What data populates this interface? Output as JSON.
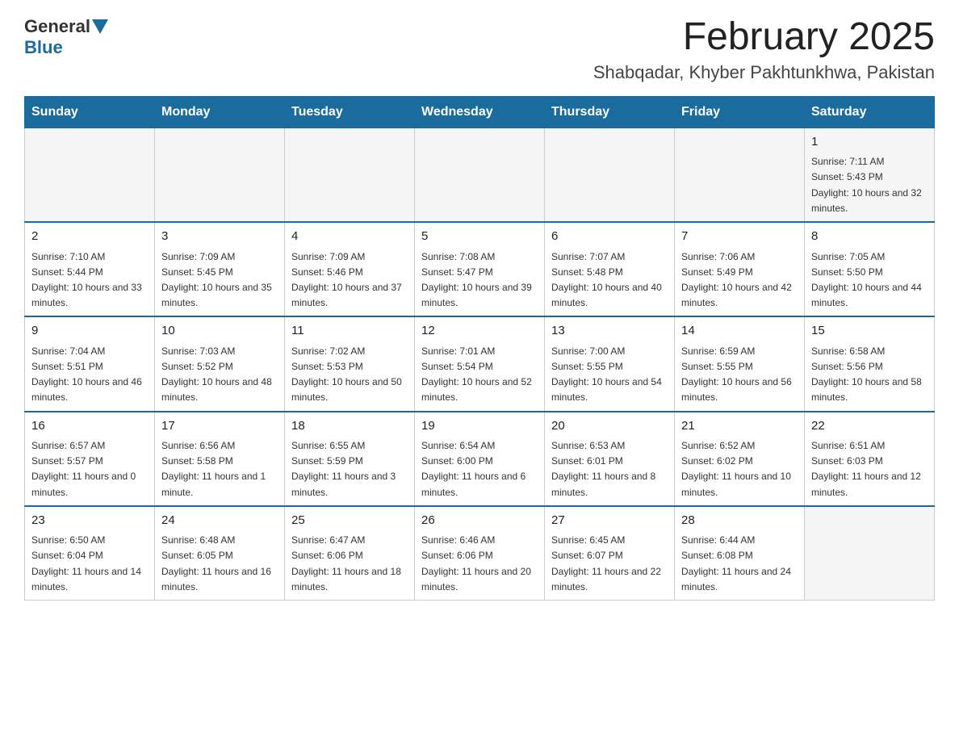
{
  "header": {
    "logo_general": "General",
    "logo_blue": "Blue",
    "month_title": "February 2025",
    "location": "Shabqadar, Khyber Pakhtunkhwa, Pakistan"
  },
  "days_of_week": [
    "Sunday",
    "Monday",
    "Tuesday",
    "Wednesday",
    "Thursday",
    "Friday",
    "Saturday"
  ],
  "weeks": [
    {
      "days": [
        {
          "num": "",
          "info": ""
        },
        {
          "num": "",
          "info": ""
        },
        {
          "num": "",
          "info": ""
        },
        {
          "num": "",
          "info": ""
        },
        {
          "num": "",
          "info": ""
        },
        {
          "num": "",
          "info": ""
        },
        {
          "num": "1",
          "info": "Sunrise: 7:11 AM\nSunset: 5:43 PM\nDaylight: 10 hours and 32 minutes."
        }
      ]
    },
    {
      "days": [
        {
          "num": "2",
          "info": "Sunrise: 7:10 AM\nSunset: 5:44 PM\nDaylight: 10 hours and 33 minutes."
        },
        {
          "num": "3",
          "info": "Sunrise: 7:09 AM\nSunset: 5:45 PM\nDaylight: 10 hours and 35 minutes."
        },
        {
          "num": "4",
          "info": "Sunrise: 7:09 AM\nSunset: 5:46 PM\nDaylight: 10 hours and 37 minutes."
        },
        {
          "num": "5",
          "info": "Sunrise: 7:08 AM\nSunset: 5:47 PM\nDaylight: 10 hours and 39 minutes."
        },
        {
          "num": "6",
          "info": "Sunrise: 7:07 AM\nSunset: 5:48 PM\nDaylight: 10 hours and 40 minutes."
        },
        {
          "num": "7",
          "info": "Sunrise: 7:06 AM\nSunset: 5:49 PM\nDaylight: 10 hours and 42 minutes."
        },
        {
          "num": "8",
          "info": "Sunrise: 7:05 AM\nSunset: 5:50 PM\nDaylight: 10 hours and 44 minutes."
        }
      ]
    },
    {
      "days": [
        {
          "num": "9",
          "info": "Sunrise: 7:04 AM\nSunset: 5:51 PM\nDaylight: 10 hours and 46 minutes."
        },
        {
          "num": "10",
          "info": "Sunrise: 7:03 AM\nSunset: 5:52 PM\nDaylight: 10 hours and 48 minutes."
        },
        {
          "num": "11",
          "info": "Sunrise: 7:02 AM\nSunset: 5:53 PM\nDaylight: 10 hours and 50 minutes."
        },
        {
          "num": "12",
          "info": "Sunrise: 7:01 AM\nSunset: 5:54 PM\nDaylight: 10 hours and 52 minutes."
        },
        {
          "num": "13",
          "info": "Sunrise: 7:00 AM\nSunset: 5:55 PM\nDaylight: 10 hours and 54 minutes."
        },
        {
          "num": "14",
          "info": "Sunrise: 6:59 AM\nSunset: 5:55 PM\nDaylight: 10 hours and 56 minutes."
        },
        {
          "num": "15",
          "info": "Sunrise: 6:58 AM\nSunset: 5:56 PM\nDaylight: 10 hours and 58 minutes."
        }
      ]
    },
    {
      "days": [
        {
          "num": "16",
          "info": "Sunrise: 6:57 AM\nSunset: 5:57 PM\nDaylight: 11 hours and 0 minutes."
        },
        {
          "num": "17",
          "info": "Sunrise: 6:56 AM\nSunset: 5:58 PM\nDaylight: 11 hours and 1 minute."
        },
        {
          "num": "18",
          "info": "Sunrise: 6:55 AM\nSunset: 5:59 PM\nDaylight: 11 hours and 3 minutes."
        },
        {
          "num": "19",
          "info": "Sunrise: 6:54 AM\nSunset: 6:00 PM\nDaylight: 11 hours and 6 minutes."
        },
        {
          "num": "20",
          "info": "Sunrise: 6:53 AM\nSunset: 6:01 PM\nDaylight: 11 hours and 8 minutes."
        },
        {
          "num": "21",
          "info": "Sunrise: 6:52 AM\nSunset: 6:02 PM\nDaylight: 11 hours and 10 minutes."
        },
        {
          "num": "22",
          "info": "Sunrise: 6:51 AM\nSunset: 6:03 PM\nDaylight: 11 hours and 12 minutes."
        }
      ]
    },
    {
      "days": [
        {
          "num": "23",
          "info": "Sunrise: 6:50 AM\nSunset: 6:04 PM\nDaylight: 11 hours and 14 minutes."
        },
        {
          "num": "24",
          "info": "Sunrise: 6:48 AM\nSunset: 6:05 PM\nDaylight: 11 hours and 16 minutes."
        },
        {
          "num": "25",
          "info": "Sunrise: 6:47 AM\nSunset: 6:06 PM\nDaylight: 11 hours and 18 minutes."
        },
        {
          "num": "26",
          "info": "Sunrise: 6:46 AM\nSunset: 6:06 PM\nDaylight: 11 hours and 20 minutes."
        },
        {
          "num": "27",
          "info": "Sunrise: 6:45 AM\nSunset: 6:07 PM\nDaylight: 11 hours and 22 minutes."
        },
        {
          "num": "28",
          "info": "Sunrise: 6:44 AM\nSunset: 6:08 PM\nDaylight: 11 hours and 24 minutes."
        },
        {
          "num": "",
          "info": ""
        }
      ]
    }
  ]
}
